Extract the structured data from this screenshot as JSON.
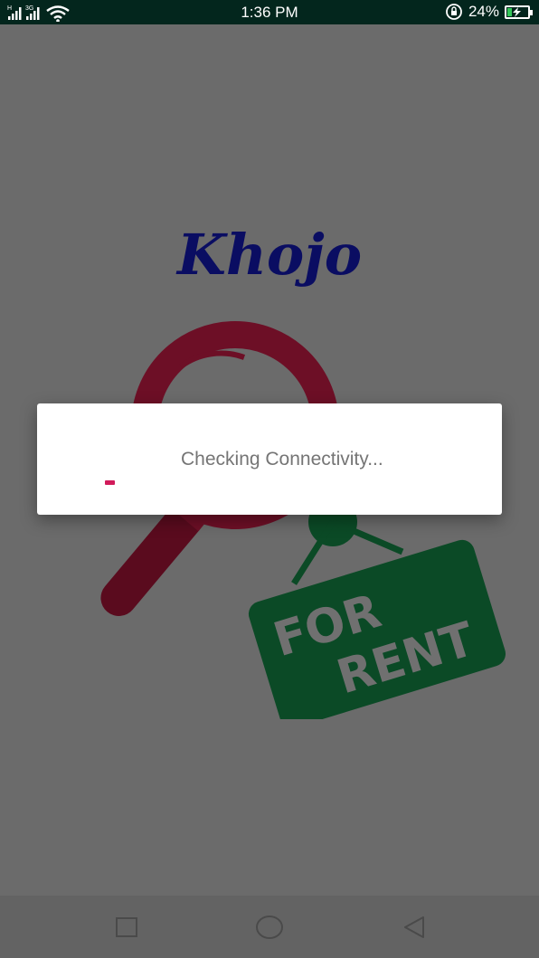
{
  "status_bar": {
    "time": "1:36 PM",
    "battery_percent": "24%",
    "battery_level": 0.24,
    "network_labels": [
      "H",
      "3G"
    ]
  },
  "app": {
    "logo_text": "Khojo",
    "sign_lines": [
      "FOR",
      "RENT"
    ]
  },
  "dialog": {
    "message": "Checking Connectivity..."
  },
  "nav_bar": {
    "buttons": [
      "recents",
      "home",
      "back"
    ]
  },
  "colors": {
    "status_bar": "#03261d",
    "overlay_background": "#6b6b6b",
    "logo": "#0a0d62",
    "magnifier": "#6d0f26",
    "sign": "#0b4a26",
    "spinner": "#d11a5a"
  }
}
